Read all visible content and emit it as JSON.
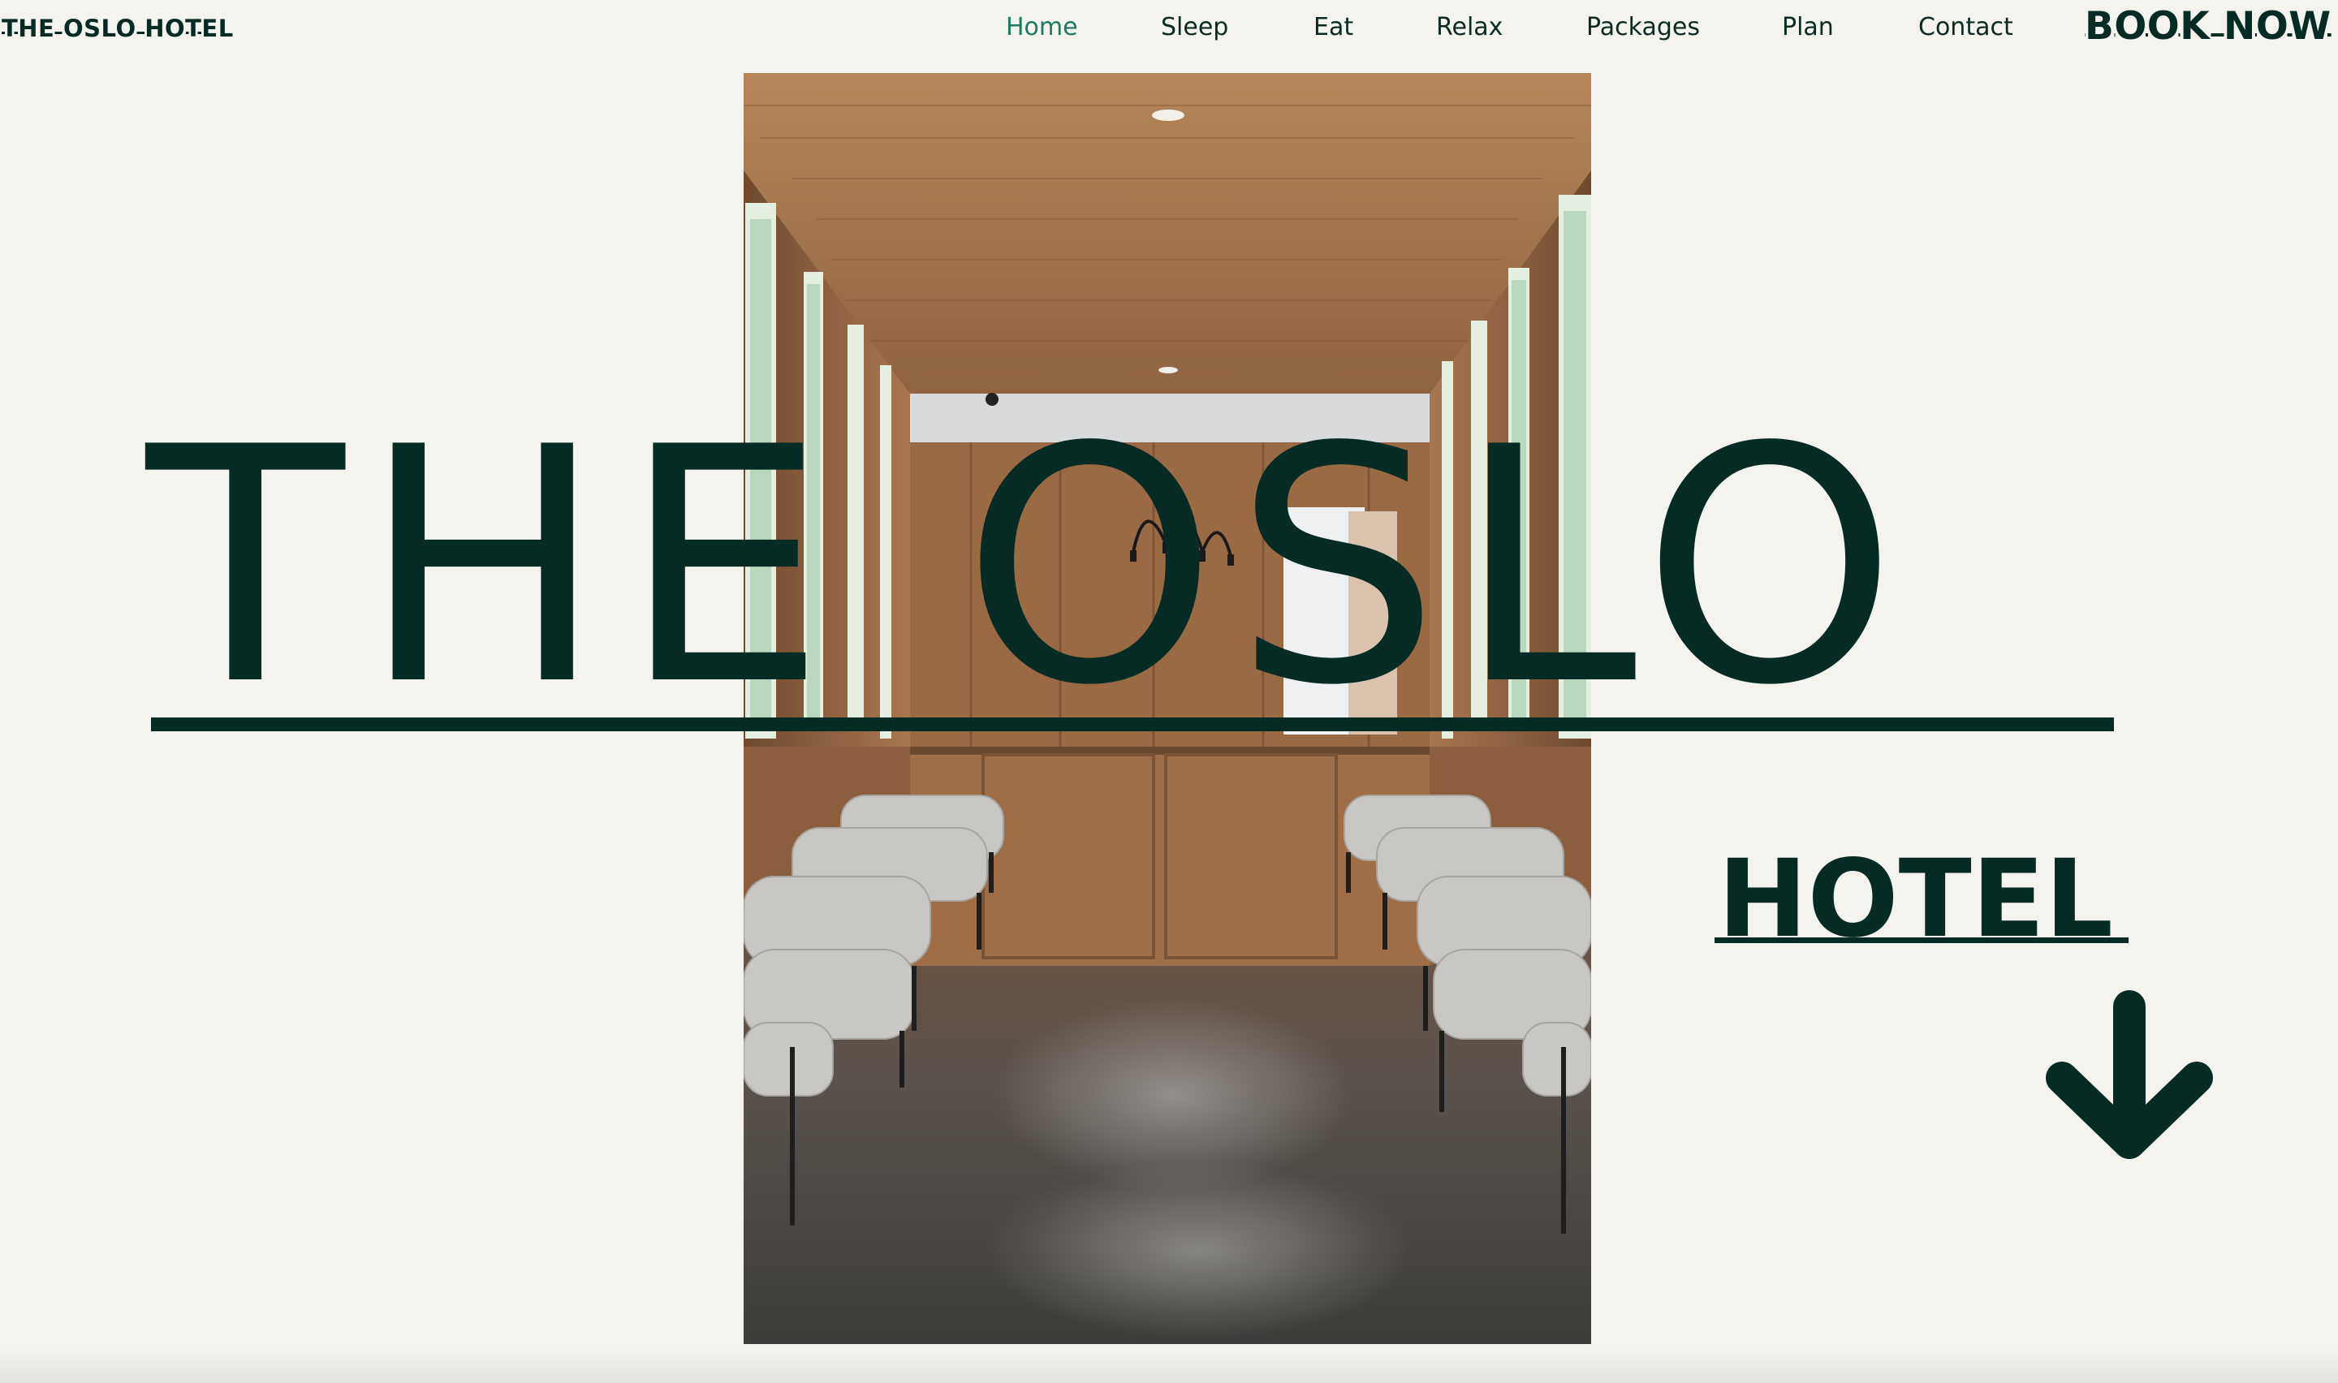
{
  "header": {
    "brand": "THE OSLO HOTEL",
    "nav": [
      {
        "label": "Home",
        "active": true
      },
      {
        "label": "Sleep",
        "active": false
      },
      {
        "label": "Eat",
        "active": false
      },
      {
        "label": "Relax",
        "active": false
      },
      {
        "label": "Packages",
        "active": false
      },
      {
        "label": "Plan",
        "active": false
      },
      {
        "label": "Contact",
        "active": false
      }
    ],
    "cta": "BOOK NOW"
  },
  "hero": {
    "title": "THE OSLO",
    "subtitle": "HOTEL",
    "image_icon": "hotel-lobby-photo",
    "scroll_icon": "arrow-down-icon"
  },
  "colors": {
    "background": "#f5f3ee",
    "brand_green": "#062b25",
    "active_nav": "#1c7a63"
  }
}
